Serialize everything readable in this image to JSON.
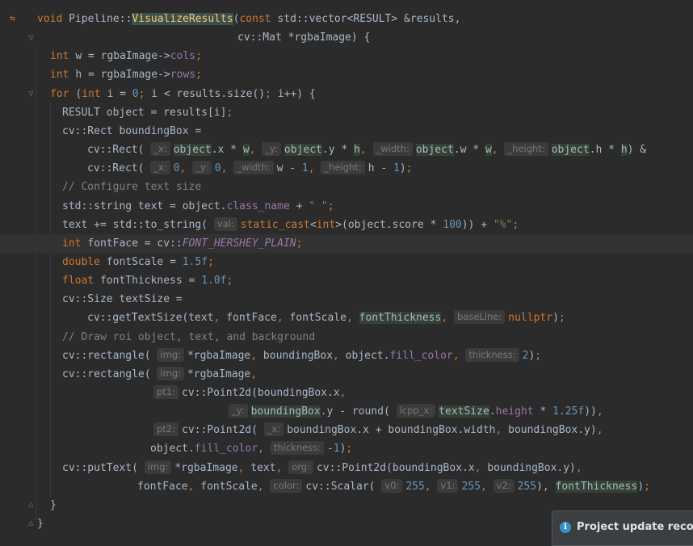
{
  "code_lines": [
    [
      [
        "kw",
        "void "
      ],
      [
        "p",
        "Pipeline::"
      ],
      [
        "fnhl",
        "VisualizeResults"
      ],
      [
        "p",
        "("
      ],
      [
        "kw",
        "const "
      ],
      [
        "p",
        "std::vector<RESULT> &results,"
      ]
    ],
    [
      [
        "p",
        "cv::Mat *rgbaImage) {"
      ]
    ],
    [
      [
        "kw",
        "int "
      ],
      [
        "p",
        "w = rgbaImage->"
      ],
      [
        "fld",
        "cols"
      ],
      [
        "kw",
        ";"
      ]
    ],
    [
      [
        "kw",
        "int "
      ],
      [
        "p",
        "h = rgbaImage->"
      ],
      [
        "fld",
        "rows"
      ],
      [
        "kw",
        ";"
      ]
    ],
    [
      [
        "kw",
        "for "
      ],
      [
        "p",
        "("
      ],
      [
        "kw",
        "int "
      ],
      [
        "p",
        "i = "
      ],
      [
        "num",
        "0"
      ],
      [
        "kw",
        "; "
      ],
      [
        "p",
        "i < results.size()"
      ],
      [
        "kw",
        "; "
      ],
      [
        "p",
        "i++) {"
      ]
    ],
    [
      [
        "p",
        "RESULT object = results[i]"
      ],
      [
        "kw",
        ";"
      ]
    ],
    [
      [
        "p",
        "cv::Rect boundingBox ="
      ]
    ],
    [
      [
        "p",
        "cv::Rect( "
      ],
      [
        "hint",
        "_x:"
      ],
      [
        "hl",
        "object"
      ],
      [
        "p",
        ".x * "
      ],
      [
        "hl",
        "w"
      ],
      [
        "kw",
        ", "
      ],
      [
        "hint",
        "_y:"
      ],
      [
        "hl",
        "object"
      ],
      [
        "p",
        ".y * "
      ],
      [
        "hl",
        "h"
      ],
      [
        "kw",
        ", "
      ],
      [
        "hint",
        "_width:"
      ],
      [
        "hl",
        "object"
      ],
      [
        "p",
        ".w * "
      ],
      [
        "hl",
        "w"
      ],
      [
        "kw",
        ", "
      ],
      [
        "hint",
        "_height:"
      ],
      [
        "hl",
        "object"
      ],
      [
        "p",
        ".h * "
      ],
      [
        "hl",
        "h"
      ],
      [
        "p",
        ") &"
      ]
    ],
    [
      [
        "p",
        "cv::Rect( "
      ],
      [
        "hint",
        "_x:"
      ],
      [
        "num",
        "0"
      ],
      [
        "kw",
        ", "
      ],
      [
        "hint",
        "_y:"
      ],
      [
        "num",
        "0"
      ],
      [
        "kw",
        ", "
      ],
      [
        "hint",
        "_width:"
      ],
      [
        "p",
        "w - "
      ],
      [
        "num",
        "1"
      ],
      [
        "kw",
        ", "
      ],
      [
        "hint",
        "_height:"
      ],
      [
        "p",
        "h - "
      ],
      [
        "num",
        "1"
      ],
      [
        "p",
        ")"
      ],
      [
        "kw",
        ";"
      ]
    ],
    [
      [
        "cmt",
        "// Configure text size"
      ]
    ],
    [
      [
        "p",
        "std::string text = object."
      ],
      [
        "fld",
        "class_name"
      ],
      [
        "p",
        " + "
      ],
      [
        "str",
        "\" \""
      ],
      [
        "kw",
        ";"
      ]
    ],
    [
      [
        "p",
        "text += std::to_string( "
      ],
      [
        "hint",
        "val:"
      ],
      [
        "kw",
        "static_cast"
      ],
      [
        "p",
        "<"
      ],
      [
        "kw",
        "int"
      ],
      [
        "p",
        ">(object.score * "
      ],
      [
        "num",
        "100"
      ],
      [
        "p",
        ")) + "
      ],
      [
        "str",
        "\"%\""
      ],
      [
        "kw",
        ";"
      ]
    ],
    [
      [
        "kw",
        "int "
      ],
      [
        "p",
        "fontFace = cv::"
      ],
      [
        "fldi",
        "FONT_HERSHEY_PLAIN"
      ],
      [
        "kw",
        ";"
      ]
    ],
    [
      [
        "kw",
        "double "
      ],
      [
        "p",
        "fontScale = "
      ],
      [
        "num",
        "1.5f"
      ],
      [
        "kw",
        ";"
      ]
    ],
    [
      [
        "kw",
        "float "
      ],
      [
        "p",
        "fontThickness = "
      ],
      [
        "num",
        "1.0f"
      ],
      [
        "kw",
        ";"
      ]
    ],
    [
      [
        "p",
        "cv::Size textSize ="
      ]
    ],
    [
      [
        "p",
        "cv::getTextSize(text"
      ],
      [
        "kw",
        ", "
      ],
      [
        "p",
        "fontFace"
      ],
      [
        "kw",
        ", "
      ],
      [
        "p",
        "fontScale"
      ],
      [
        "kw",
        ", "
      ],
      [
        "hl",
        "fontThickness"
      ],
      [
        "kw",
        ", "
      ],
      [
        "hint",
        "baseLine:"
      ],
      [
        "kw",
        "nullptr"
      ],
      [
        "p",
        ")"
      ],
      [
        "kw",
        ";"
      ]
    ],
    [
      [
        "cmt",
        "// Draw roi object, text, and background"
      ]
    ],
    [
      [
        "p",
        "cv::rectangle( "
      ],
      [
        "hint",
        "img:"
      ],
      [
        "p",
        "*rgbaImage"
      ],
      [
        "kw",
        ", "
      ],
      [
        "p",
        "boundingBox"
      ],
      [
        "kw",
        ", "
      ],
      [
        "p",
        "object."
      ],
      [
        "fld",
        "fill_color"
      ],
      [
        "kw",
        ", "
      ],
      [
        "hint",
        "thickness:"
      ],
      [
        "num",
        "2"
      ],
      [
        "p",
        ")"
      ],
      [
        "kw",
        ";"
      ]
    ],
    [
      [
        "p",
        "cv::rectangle( "
      ],
      [
        "hint",
        "img:"
      ],
      [
        "p",
        "*rgbaImage"
      ],
      [
        "kw",
        ","
      ]
    ],
    [
      [
        "hint",
        "pt1:"
      ],
      [
        "p",
        "cv::Point2d(boundingBox.x"
      ],
      [
        "kw",
        ","
      ]
    ],
    [
      [
        "hint",
        "_y:"
      ],
      [
        "hl",
        "boundingBox"
      ],
      [
        "p",
        ".y - round( "
      ],
      [
        "hint",
        "lcpp_x:"
      ],
      [
        "hl",
        "textSize"
      ],
      [
        "p",
        "."
      ],
      [
        "fld",
        "height"
      ],
      [
        "p",
        " * "
      ],
      [
        "num",
        "1.25f"
      ],
      [
        "p",
        "))"
      ],
      [
        "kw",
        ","
      ]
    ],
    [
      [
        "hint",
        "pt2:"
      ],
      [
        "p",
        "cv::Point2d( "
      ],
      [
        "hint",
        "_x:"
      ],
      [
        "p",
        "boundingBox.x + boundingBox.width"
      ],
      [
        "kw",
        ", "
      ],
      [
        "p",
        "boundingBox.y)"
      ],
      [
        "kw",
        ","
      ]
    ],
    [
      [
        "p",
        "object."
      ],
      [
        "fld",
        "fill_color"
      ],
      [
        "kw",
        ", "
      ],
      [
        "hint",
        "thickness:"
      ],
      [
        "p",
        "-"
      ],
      [
        "num",
        "1"
      ],
      [
        "p",
        ")"
      ],
      [
        "kw",
        ";"
      ]
    ],
    [
      [
        "p",
        "cv::putText( "
      ],
      [
        "hint",
        "img:"
      ],
      [
        "p",
        "*rgbaImage"
      ],
      [
        "kw",
        ", "
      ],
      [
        "p",
        "text"
      ],
      [
        "kw",
        ", "
      ],
      [
        "hint",
        "org:"
      ],
      [
        "p",
        "cv::Point2d(boundingBox.x"
      ],
      [
        "kw",
        ", "
      ],
      [
        "p",
        "boundingBox.y)"
      ],
      [
        "kw",
        ","
      ]
    ],
    [
      [
        "p",
        "fontFace"
      ],
      [
        "kw",
        ", "
      ],
      [
        "p",
        "fontScale"
      ],
      [
        "kw",
        ", "
      ],
      [
        "hint",
        "color:"
      ],
      [
        "p",
        "cv::Scalar( "
      ],
      [
        "hint",
        "v0:"
      ],
      [
        "num",
        "255"
      ],
      [
        "kw",
        ", "
      ],
      [
        "hint",
        "v1:"
      ],
      [
        "num",
        "255"
      ],
      [
        "kw",
        ", "
      ],
      [
        "hint",
        "v2:"
      ],
      [
        "num",
        "255"
      ],
      [
        "p",
        "), "
      ],
      [
        "hl",
        "fontThickness"
      ],
      [
        "p",
        ")"
      ],
      [
        "kw",
        ";"
      ]
    ],
    [
      [
        "p",
        "}"
      ]
    ],
    [
      [
        "p",
        "}"
      ]
    ]
  ],
  "notification": {
    "icon": "info-icon",
    "text": "Project update recomme"
  },
  "colors": {
    "background": "#2b2b2b",
    "keyword": "#cc7832",
    "function": "#ffc66d",
    "number": "#6897bb",
    "string": "#6a8759",
    "comment": "#808080",
    "field": "#9876aa",
    "text": "#a9b7c6"
  }
}
